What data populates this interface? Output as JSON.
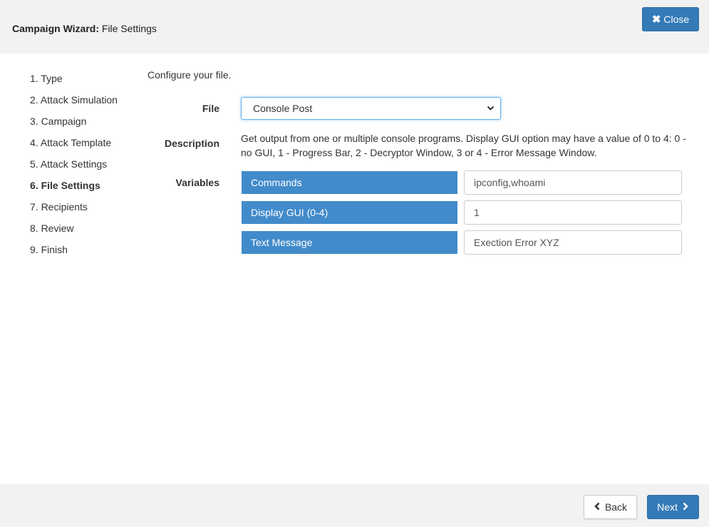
{
  "header": {
    "title_bold": "Campaign Wizard:",
    "title_rest": " File Settings",
    "close_icon": "✖",
    "close_label": "Close"
  },
  "steps": [
    "1. Type",
    "2. Attack Simulation",
    "3. Campaign",
    "4. Attack Template",
    "5. Attack Settings",
    "6. File Settings",
    "7. Recipients",
    "8. Review",
    "9. Finish"
  ],
  "active_step": 5,
  "form": {
    "intro": "Configure your file.",
    "file_label": "File",
    "file_value": "Console Post",
    "description_label": "Description",
    "description_text": "Get output from one or multiple console programs. Display GUI option may have a value of 0 to 4: 0 - no GUI, 1 - Progress Bar, 2 - Decryptor Window, 3 or 4 - Error Message Window.",
    "variables_label": "Variables",
    "variables": [
      {
        "name": "Commands",
        "value": "ipconfig,whoami"
      },
      {
        "name": "Display GUI (0-4)",
        "value": "1"
      },
      {
        "name": "Text Message",
        "value": "Exection Error XYZ"
      }
    ]
  },
  "footer": {
    "back_label": "Back",
    "next_label": "Next"
  },
  "colors": {
    "primary": "#337ab7",
    "variable_bg": "#428bca",
    "bar_bg": "#f2f2f2"
  }
}
